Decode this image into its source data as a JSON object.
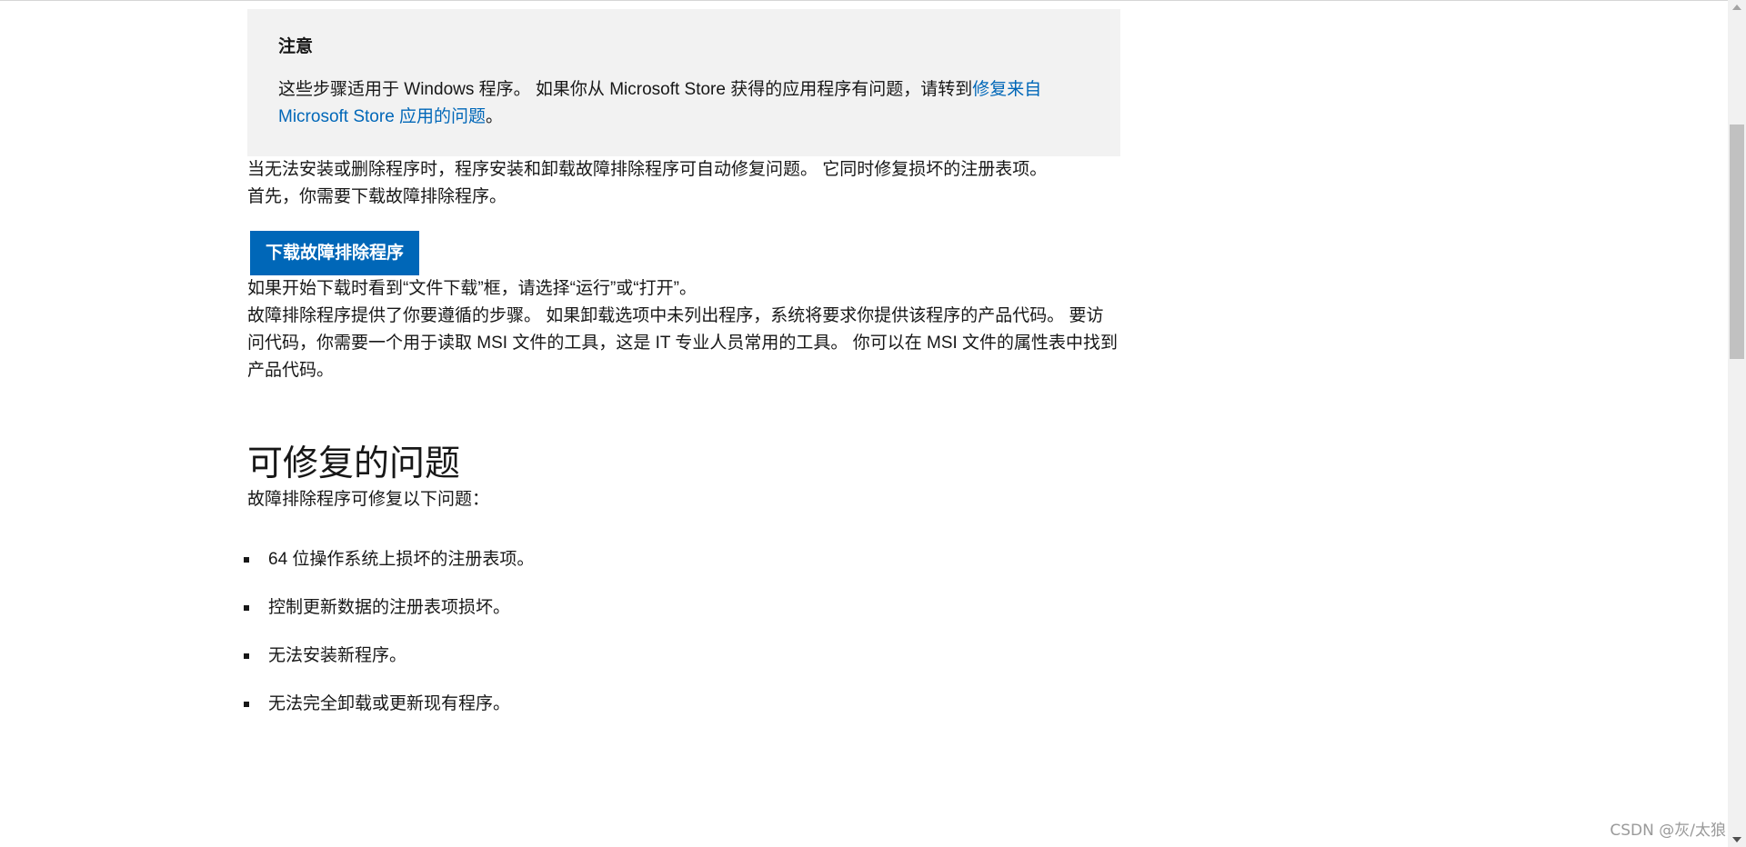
{
  "note": {
    "title": "注意",
    "text_before": "这些步骤适用于 Windows 程序。 如果你从 Microsoft Store 获得的应用程序有问题，请转到",
    "link": "修复来自 Microsoft Store 应用的问题",
    "text_after": "。"
  },
  "paragraphs": {
    "p1": "当无法安装或删除程序时，程序安装和卸载故障排除程序可自动修复问题。 它同时修复损坏的注册表项。",
    "p2": "首先，你需要下载故障排除程序。",
    "p3": "如果开始下载时看到“文件下载”框，请选择“运行”或“打开”。",
    "p4": "故障排除程序提供了你要遵循的步骤。 如果卸载选项中未列出程序，系统将要求你提供该程序的产品代码。 要访问代码，你需要一个用于读取 MSI 文件的工具，这是 IT 专业人员常用的工具。 你可以在 MSI 文件的属性表中找到产品代码。"
  },
  "download_button": "下载故障排除程序",
  "section": {
    "heading": "可修复的问题",
    "intro": "故障排除程序可修复以下问题：",
    "items": [
      "64 位操作系统上损坏的注册表项。",
      "控制更新数据的注册表项损坏。",
      "无法安装新程序。",
      "无法完全卸载或更新现有程序。"
    ]
  },
  "watermark": "CSDN @灰/太狼"
}
